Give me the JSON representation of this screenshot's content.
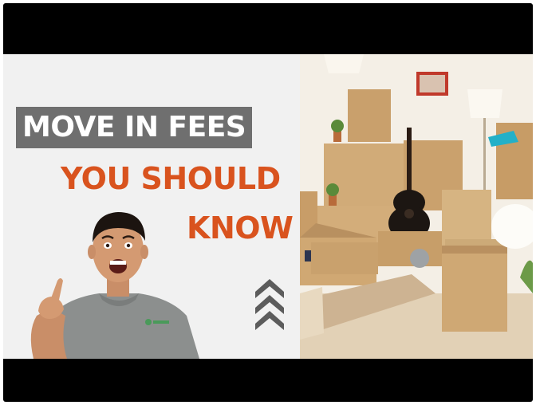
{
  "thumbnail": {
    "headline_line1": "MOVE IN FEES",
    "headline_line2": "YOU SHOULD",
    "headline_line3": "KNOW"
  },
  "colors": {
    "accent_orange": "#d9531e",
    "title_box_gray": "#6f6f6f",
    "letterbox": "#000000",
    "panel_background": "#f1f1f1",
    "chevron_gray": "#5c5c5c"
  },
  "icons": {
    "chevrons": "triple-chevron-up-icon"
  }
}
